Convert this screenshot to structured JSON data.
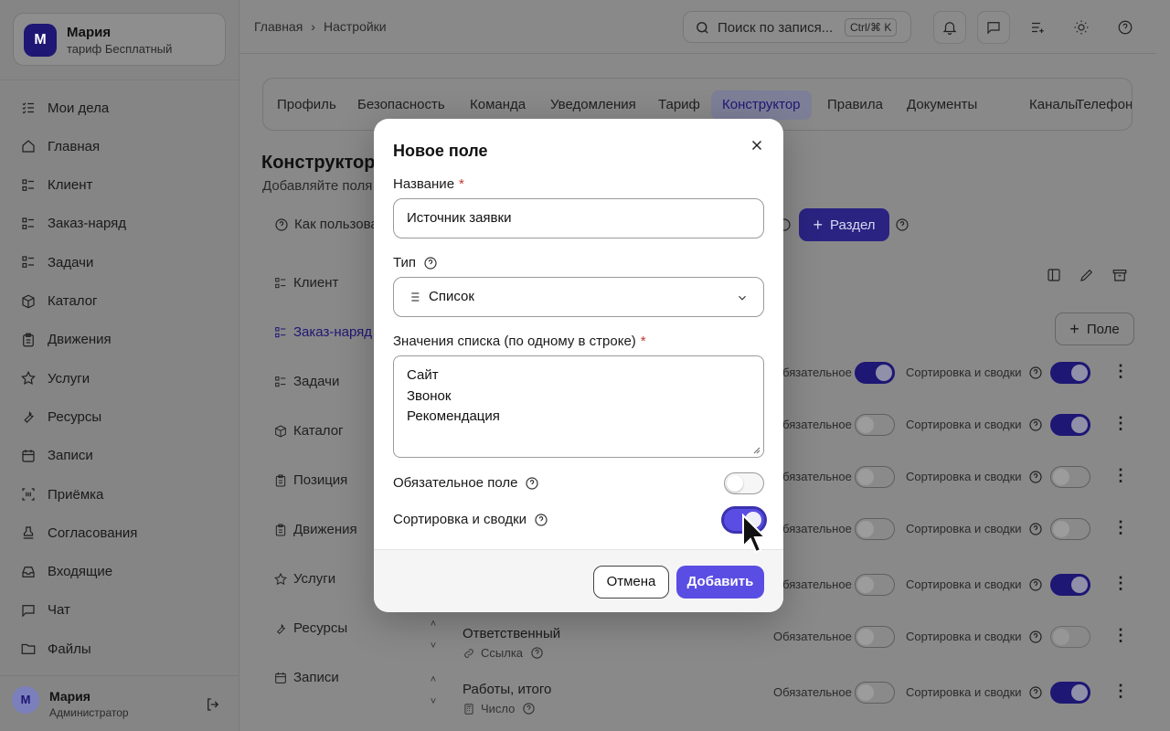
{
  "account": {
    "initial": "М",
    "name": "Мария",
    "plan": "тариф Бесплатный"
  },
  "nav": [
    {
      "label": "Мои дела",
      "icon": "checklist-icon"
    },
    {
      "label": "Главная",
      "icon": "home-icon"
    },
    {
      "label": "Клиент",
      "icon": "list-icon"
    },
    {
      "label": "Заказ-наряд",
      "icon": "list-icon"
    },
    {
      "label": "Задачи",
      "icon": "list-icon"
    },
    {
      "label": "Каталог",
      "icon": "box-icon"
    },
    {
      "label": "Движения",
      "icon": "clipboard-icon"
    },
    {
      "label": "Услуги",
      "icon": "star-icon"
    },
    {
      "label": "Ресурсы",
      "icon": "wrench-icon"
    },
    {
      "label": "Записи",
      "icon": "calendar-icon"
    },
    {
      "label": "Приёмка",
      "icon": "scan-icon"
    },
    {
      "label": "Согласования",
      "icon": "stamp-icon"
    },
    {
      "label": "Входящие",
      "icon": "inbox-icon"
    },
    {
      "label": "Чат",
      "icon": "chat-icon"
    },
    {
      "label": "Файлы",
      "icon": "folder-icon"
    }
  ],
  "user": {
    "initial": "М",
    "name": "Мария",
    "role": "Администратор"
  },
  "breadcrumb": {
    "home": "Главная",
    "sep": "›",
    "current": "Настройки"
  },
  "search": {
    "placeholder": "Поиск по запися...",
    "shortcut": "Ctrl/⌘ K"
  },
  "tabs": [
    "Профиль",
    "Безопасность",
    "Команда",
    "Уведомления",
    "Тариф",
    "Конструктор",
    "Правила",
    "Документы",
    "Каналы",
    "Телефония"
  ],
  "active_tab": "Конструктор",
  "page": {
    "title": "Конструктор",
    "subtitle": "Добавляйте поля",
    "howto": "Как пользова",
    "add_section": "Раздел",
    "add_field": "Поле"
  },
  "sections": [
    "Клиент",
    "Заказ-наряд",
    "Задачи",
    "Каталог",
    "Позиция",
    "Движения",
    "Услуги",
    "Ресурсы",
    "Записи"
  ],
  "active_section": "Заказ-наряд",
  "row_labels": {
    "required": "Обязательное",
    "sort": "Сортировка и сводки"
  },
  "fields": [
    {
      "required": true,
      "sort": true
    },
    {
      "required": false,
      "sort": true
    },
    {
      "required": false,
      "sort": false
    },
    {
      "required": false,
      "sort": false
    },
    {
      "required": false,
      "sort": true
    },
    {
      "name": "Ответственный",
      "type": "Ссылка",
      "required": false,
      "sort": false
    },
    {
      "name": "Работы, итого",
      "type": "Число",
      "required": false,
      "sort": true
    }
  ],
  "modal": {
    "title": "Новое поле",
    "name_label": "Название",
    "name_value": "Источник заявки",
    "type_label": "Тип",
    "type_value": "Список",
    "values_label": "Значения списка (по одному в строке)",
    "values": [
      "Сайт",
      "Звонок",
      "Рекомендация"
    ],
    "required_label": "Обязательное поле",
    "required_on": false,
    "sort_label": "Сортировка и сводки",
    "sort_on": true,
    "cancel": "Отмена",
    "add": "Добавить"
  },
  "colors": {
    "accent": "#5a4de3",
    "required_star": "#c0392b"
  }
}
